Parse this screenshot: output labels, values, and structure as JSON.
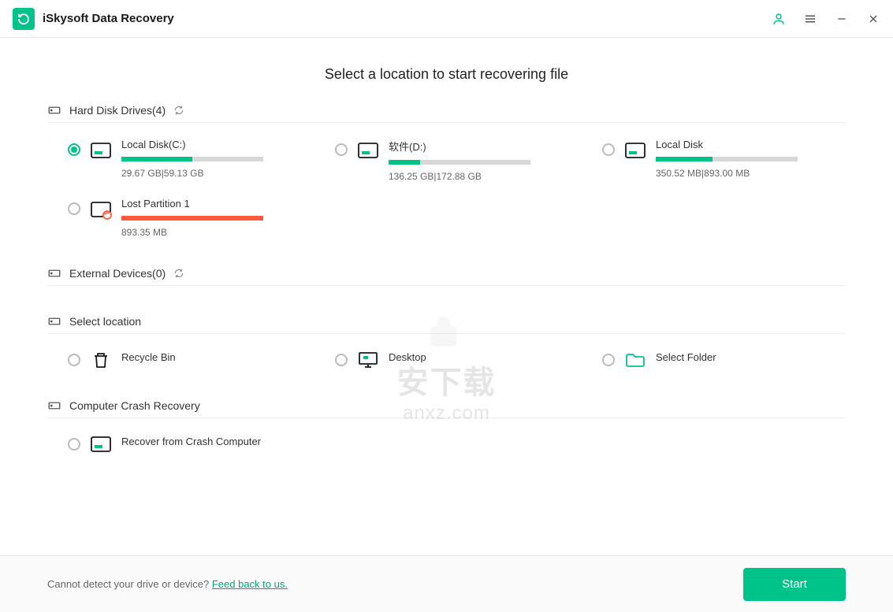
{
  "app": {
    "title": "iSkysoft Data Recovery"
  },
  "page": {
    "heading": "Select a location to start recovering file"
  },
  "sections": {
    "hdd": {
      "label": "Hard Disk Drives(4)"
    },
    "external": {
      "label": "External Devices(0)"
    },
    "location": {
      "label": "Select location"
    },
    "crash": {
      "label": "Computer Crash Recovery"
    }
  },
  "drives": {
    "c": {
      "name": "Local Disk(C:)",
      "size": "29.67  GB|59.13  GB",
      "fill_pct": 50
    },
    "d": {
      "name": "软件(D:)",
      "size": "136.25  GB|172.88  GB",
      "fill_pct": 22
    },
    "local": {
      "name": "Local Disk",
      "size": "350.52  MB|893.00  MB",
      "fill_pct": 40
    },
    "lost": {
      "name": "Lost Partition 1",
      "size": "893.35  MB",
      "fill_pct": 100
    }
  },
  "locations": {
    "recycle": {
      "name": "Recycle Bin"
    },
    "desktop": {
      "name": "Desktop"
    },
    "folder": {
      "name": "Select Folder"
    }
  },
  "crash": {
    "recover": {
      "name": "Recover from Crash Computer"
    }
  },
  "footer": {
    "prompt": "Cannot detect your drive or device? ",
    "link": "Feed back to us.",
    "start": "Start"
  },
  "watermark": {
    "text": "安下载",
    "sub": "anxz.com"
  },
  "colors": {
    "accent": "#00c389",
    "danger": "#ff5a3c"
  }
}
